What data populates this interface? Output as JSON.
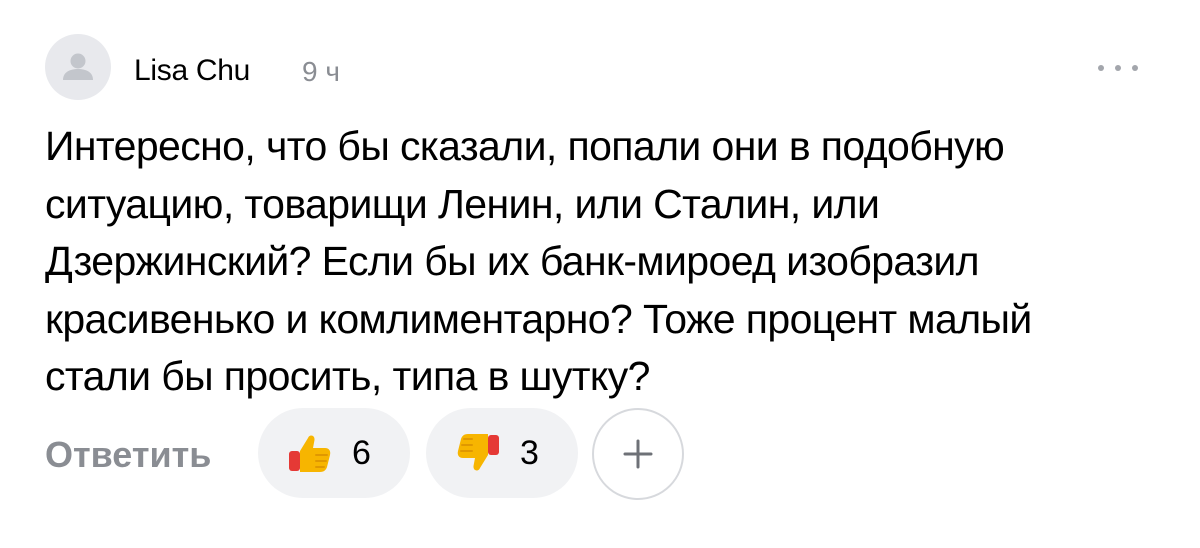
{
  "comment": {
    "author": "Lisa Chu",
    "time": "9 ч",
    "text": "Интересно, что бы сказали, попали они в подобную\nситуацию, товарищи Ленин, или Сталин, или\nДзержинский? Если бы их банк-мироед изобразил\nкрасивенько и комлиментарно? Тоже процент малый\nстали бы просить, типа в шутку?"
  },
  "actions": {
    "reply_label": "Ответить",
    "likes": "6",
    "dislikes": "3"
  },
  "icons": {
    "avatar": "user-silhouette-icon",
    "more": "more-dots-icon",
    "like": "thumbs-up-icon",
    "dislike": "thumbs-down-icon",
    "add": "plus-icon"
  },
  "colors": {
    "secondary_text": "#8a8d93",
    "pill_background": "#f1f2f4",
    "avatar_background": "#e8e9ed",
    "thumb_yellow": "#f7b500",
    "thumb_cuff": "#e53935"
  }
}
